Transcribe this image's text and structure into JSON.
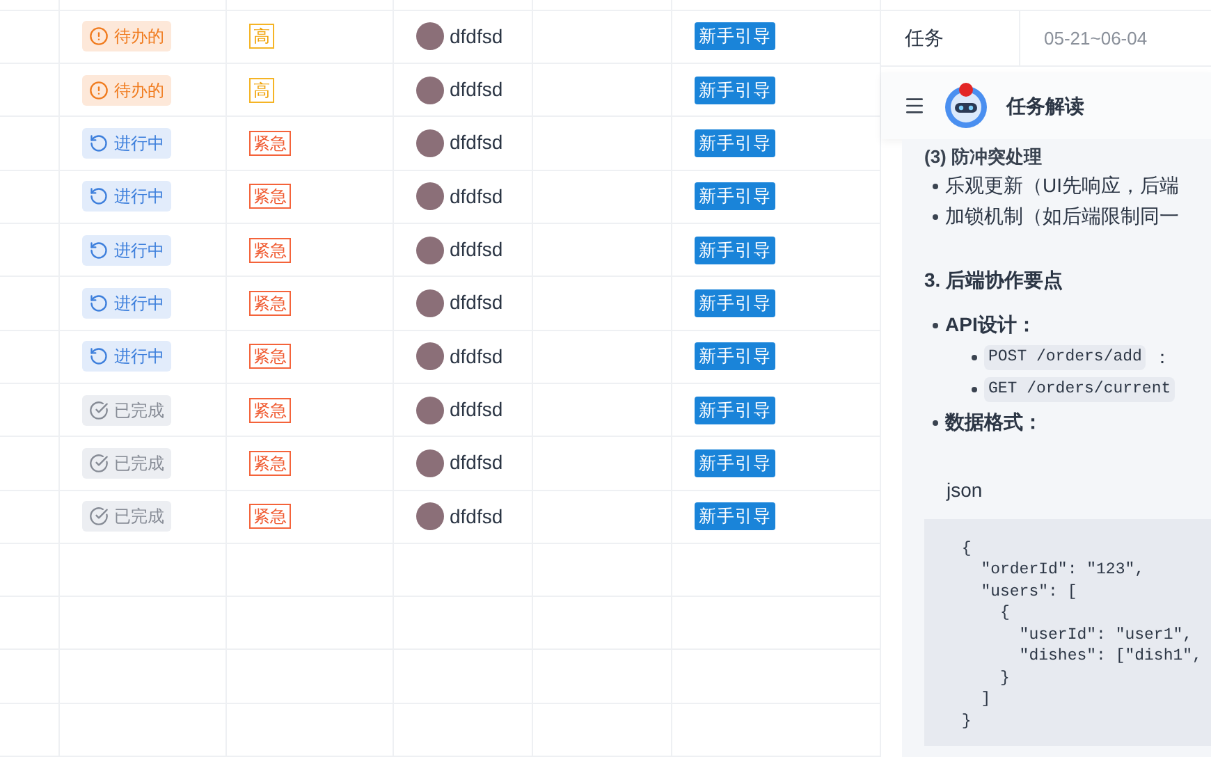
{
  "table": {
    "rows": [
      {
        "status": {
          "kind": "todo",
          "label": "待办的"
        },
        "priority": {
          "kind": "high",
          "label": "高"
        },
        "assignee": "dfdfsd",
        "tag": "新手引导"
      },
      {
        "status": {
          "kind": "todo",
          "label": "待办的"
        },
        "priority": {
          "kind": "high",
          "label": "高"
        },
        "assignee": "dfdfsd",
        "tag": "新手引导"
      },
      {
        "status": {
          "kind": "in_progress",
          "label": "进行中"
        },
        "priority": {
          "kind": "urgent",
          "label": "紧急"
        },
        "assignee": "dfdfsd",
        "tag": "新手引导"
      },
      {
        "status": {
          "kind": "in_progress",
          "label": "进行中"
        },
        "priority": {
          "kind": "urgent",
          "label": "紧急"
        },
        "assignee": "dfdfsd",
        "tag": "新手引导"
      },
      {
        "status": {
          "kind": "in_progress",
          "label": "进行中"
        },
        "priority": {
          "kind": "urgent",
          "label": "紧急"
        },
        "assignee": "dfdfsd",
        "tag": "新手引导"
      },
      {
        "status": {
          "kind": "in_progress",
          "label": "进行中"
        },
        "priority": {
          "kind": "urgent",
          "label": "紧急"
        },
        "assignee": "dfdfsd",
        "tag": "新手引导"
      },
      {
        "status": {
          "kind": "in_progress",
          "label": "进行中"
        },
        "priority": {
          "kind": "urgent",
          "label": "紧急"
        },
        "assignee": "dfdfsd",
        "tag": "新手引导"
      },
      {
        "status": {
          "kind": "done",
          "label": "已完成"
        },
        "priority": {
          "kind": "urgent",
          "label": "紧急"
        },
        "assignee": "dfdfsd",
        "tag": "新手引导"
      },
      {
        "status": {
          "kind": "done",
          "label": "已完成"
        },
        "priority": {
          "kind": "urgent",
          "label": "紧急"
        },
        "assignee": "dfdfsd",
        "tag": "新手引导"
      },
      {
        "status": {
          "kind": "done",
          "label": "已完成"
        },
        "priority": {
          "kind": "urgent",
          "label": "紧急"
        },
        "assignee": "dfdfsd",
        "tag": "新手引导"
      }
    ]
  },
  "side_row": {
    "label": "任务",
    "date": "05-21~06-04"
  },
  "panel": {
    "title": "任务解读",
    "blocks": [
      {
        "kind": "subheading",
        "text": "(3) 防冲突处理"
      },
      {
        "kind": "bullet",
        "text": "乐观更新（UI先响应，后端"
      },
      {
        "kind": "bullet",
        "text": "加锁机制（如后端限制同一"
      },
      {
        "kind": "heading",
        "text": "3. 后端协作要点"
      },
      {
        "kind": "bold_bullet",
        "text": "API设计："
      },
      {
        "kind": "code_bullet",
        "code": "POST /orders/add",
        "text": "："
      },
      {
        "kind": "code_bullet",
        "code": "GET /orders/current"
      },
      {
        "kind": "bold_bullet",
        "text": "数据格式："
      },
      {
        "kind": "lang",
        "text": "json"
      },
      {
        "kind": "code",
        "lines": [
          " {",
          "   \"orderId\": \"123\",",
          "   \"users\": [",
          "     {",
          "       \"userId\": \"user1\",",
          "       \"dishes\": [\"dish1\",",
          "     }",
          "   ]",
          " }"
        ]
      }
    ]
  }
}
